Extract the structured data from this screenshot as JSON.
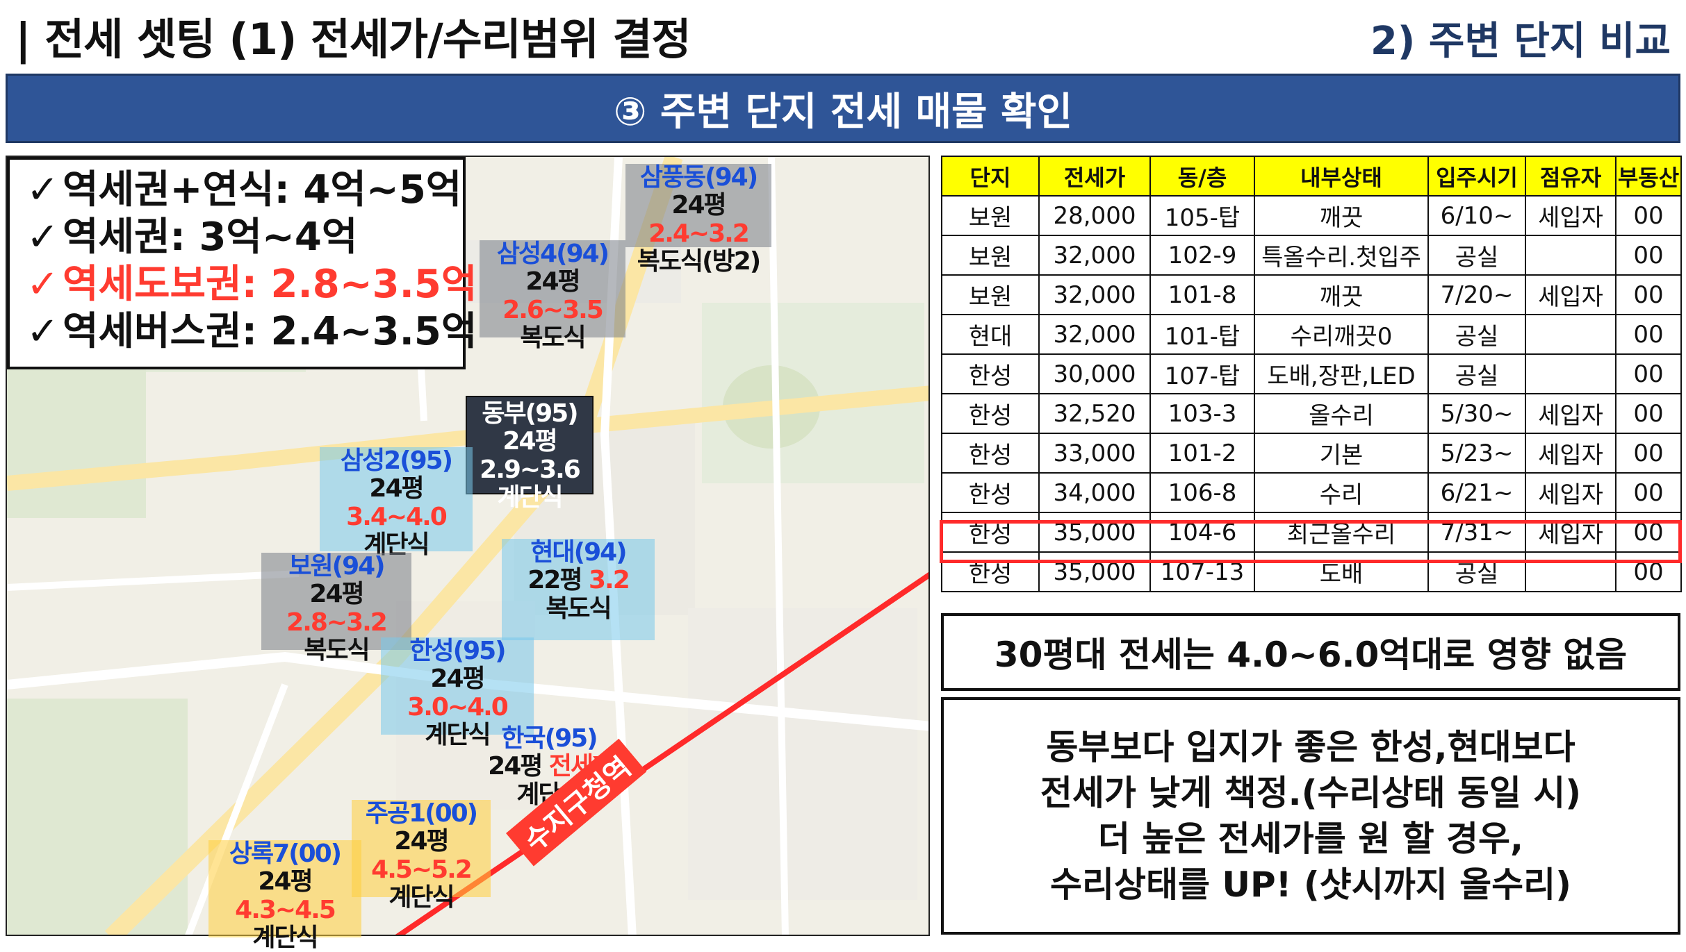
{
  "header": {
    "title": "| 전세 셋팅 (1) 전세가/수리범위 결정",
    "subtitle": "2) 주변 단지 비교",
    "banner": "③ 주변 단지 전세 매물 확인"
  },
  "legend": [
    {
      "check": "✓",
      "text": "역세권+연식: 4억~5억"
    },
    {
      "check": "✓",
      "text": "역세권: 3억~4억"
    },
    {
      "check": "✓",
      "text": "역세도보권: 2.8~3.5억"
    },
    {
      "check": "✓",
      "text": "역세버스권: 2.4~3.5억"
    }
  ],
  "complexes": {
    "sampung": {
      "name": "삼풍동(94)",
      "py": "24평 ",
      "range": "2.4~3.2",
      "type": "복도식(방2)"
    },
    "samsung4": {
      "name": "삼성4(94)",
      "py": "24평 ",
      "range": "2.6~3.5",
      "type": "복도식"
    },
    "dongbu": {
      "name": "동부(95)",
      "py": "24평 2.9~3.6",
      "type": "계단식"
    },
    "samsung2": {
      "name": "삼성2(95)",
      "py": "24평 ",
      "range": "3.4~4.0",
      "type": "계단식"
    },
    "bowon": {
      "name": "보원(94)",
      "py": "24평 ",
      "range": "2.8~3.2",
      "type": "복도식"
    },
    "hyundai": {
      "name": "현대(94)",
      "py": "22평 ",
      "range": "3.2",
      "type": "복도식"
    },
    "hansung": {
      "name": "한성(95)",
      "py": "24평 ",
      "range": "3.0~4.0",
      "type": "계단식"
    },
    "hankook": {
      "name": "한국(95)",
      "py": "24평 ",
      "range": "전세X",
      "type": "계단식"
    },
    "jugong1": {
      "name": "주공1(00)",
      "py": "24평 ",
      "range": "4.5~5.2",
      "type": "계단식"
    },
    "sangrok7": {
      "name": "상록7(00)",
      "py": "24평 ",
      "range": "4.3~4.5",
      "type": "계단식"
    }
  },
  "map_label": "수지구청역",
  "table": {
    "headers": [
      "단지",
      "전세가",
      "동/층",
      "내부상태",
      "입주시기",
      "점유자",
      "부동산"
    ],
    "rows": [
      [
        "보원",
        "28,000",
        "105-탑",
        "깨끗",
        "6/10~",
        "세입자",
        "00"
      ],
      [
        "보원",
        "32,000",
        "102-9",
        "특올수리.첫입주",
        "공실",
        "",
        "00"
      ],
      [
        "보원",
        "32,000",
        "101-8",
        "깨끗",
        "7/20~",
        "세입자",
        "00"
      ],
      [
        "현대",
        "32,000",
        "101-탑",
        "수리깨끗0",
        "공실",
        "",
        "00"
      ],
      [
        "한성",
        "30,000",
        "107-탑",
        "도배,장판,LED",
        "공실",
        "",
        "00"
      ],
      [
        "한성",
        "32,520",
        "103-3",
        "올수리",
        "5/30~",
        "세입자",
        "00"
      ],
      [
        "한성",
        "33,000",
        "101-2",
        "기본",
        "5/23~",
        "세입자",
        "00"
      ],
      [
        "한성",
        "34,000",
        "106-8",
        "수리",
        "6/21~",
        "세입자",
        "00"
      ],
      [
        "한성",
        "35,000",
        "104-6",
        "최근올수리",
        "7/31~",
        "세입자",
        "00"
      ],
      [
        "한성",
        "35,000",
        "107-13",
        "도배",
        "공실",
        "",
        "00"
      ]
    ]
  },
  "note1": "30평대 전세는 4.0~6.0억대로 영향 없음",
  "note2": [
    "동부보다 입지가 좋은 한성,현대보다",
    "전세가 낮게 책정.(수리상태 동일 시)",
    "더 높은 전세가를 원 할 경우,",
    "수리상태를 UP! (샷시까지 올수리)"
  ],
  "colors": {
    "banner": "#2f5597",
    "accent_red": "#ff3b30",
    "header_yellow": "#ffff00",
    "name_blue": "#1a4fd8"
  }
}
